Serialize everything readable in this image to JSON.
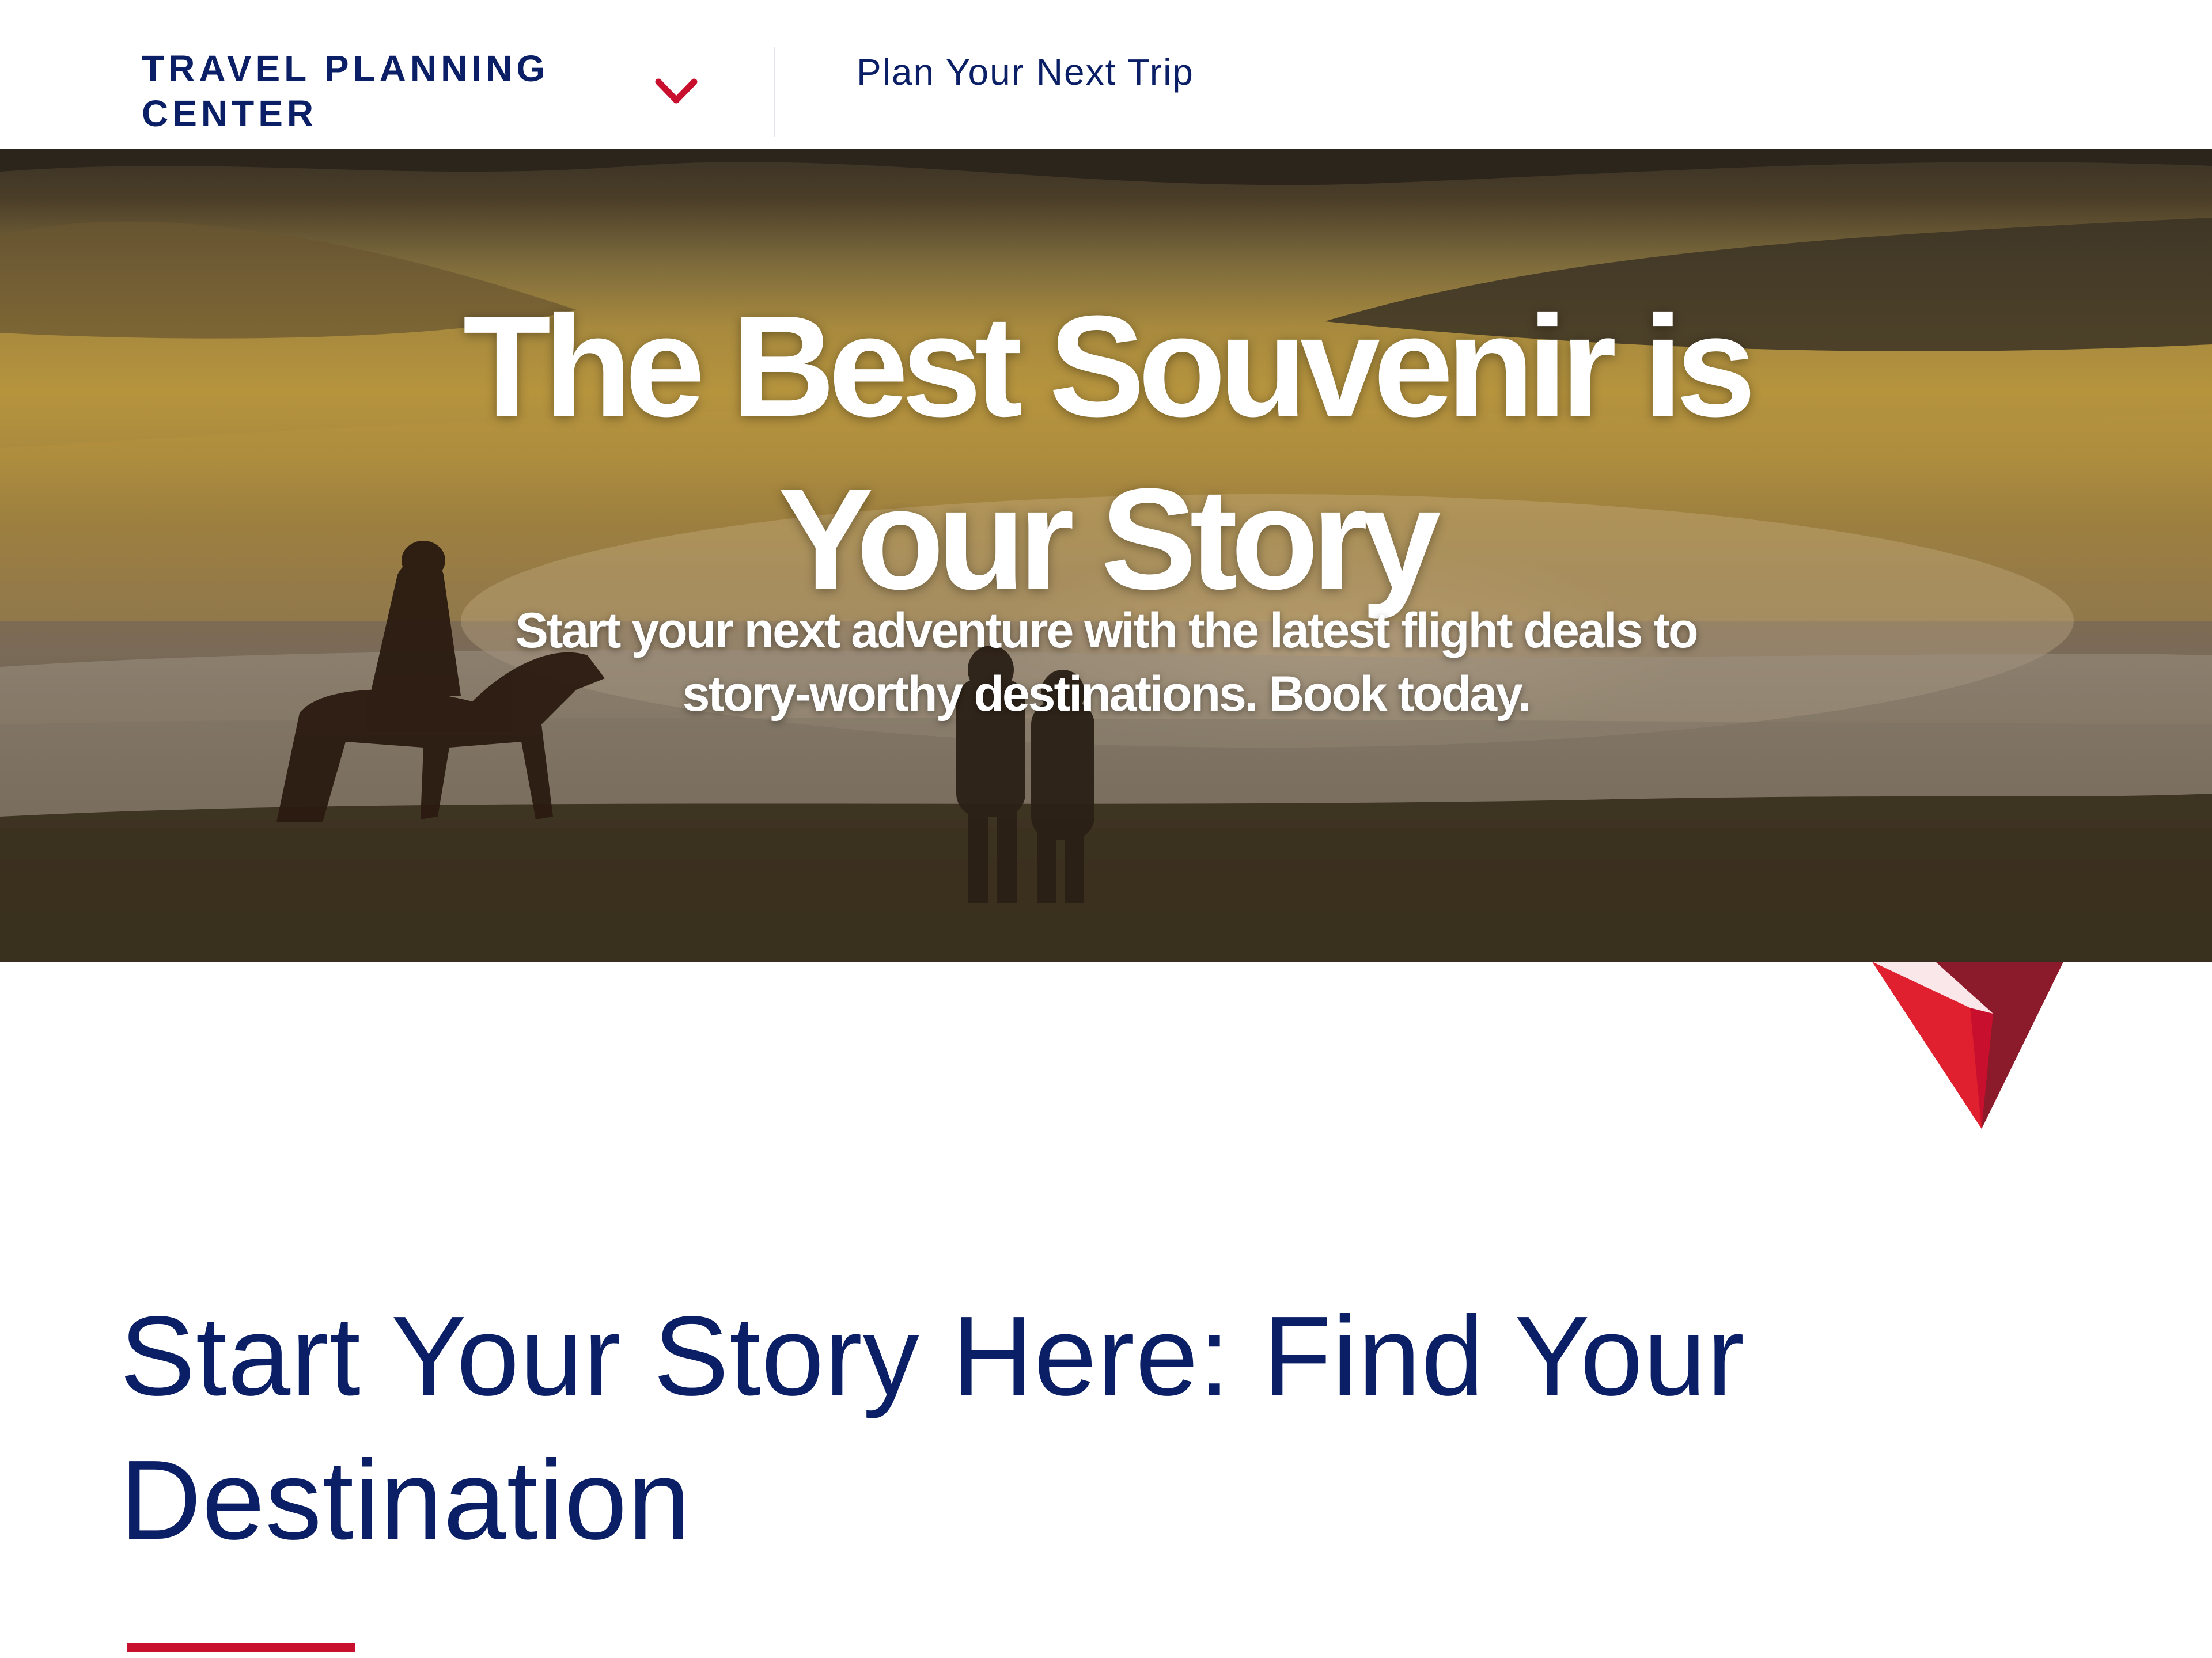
{
  "nav": {
    "section_label": "TRAVEL PLANNING CENTER",
    "link_label": "Plan Your Next Trip"
  },
  "hero": {
    "title": "The Best Souvenir is Your Story",
    "subtitle": "Start your next adventure with the latest flight deals to story-worthy destinations. Book today."
  },
  "main": {
    "section_heading": "Start Your Story Here: Find Your Destination"
  },
  "colors": {
    "navy": "#0b1f66",
    "accent_red": "#c8102e",
    "logo_red_dark": "#8b1a2b",
    "divider": "#e3e5ea"
  },
  "icons": {
    "nav_dropdown": "chevron-down-icon",
    "brand": "delta-widget-logo"
  }
}
